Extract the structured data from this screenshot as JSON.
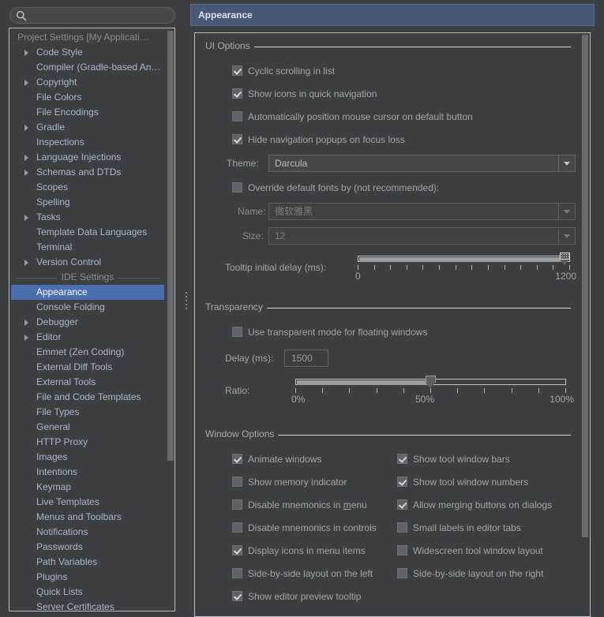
{
  "search": {
    "placeholder": "",
    "value": "",
    "icon": "search-icon"
  },
  "sidebar": {
    "project_group": "Project Settings [My Applicati…",
    "ide_group": "IDE Settings",
    "project_items": [
      {
        "label": "Code Style",
        "arrow": true
      },
      {
        "label": "Compiler (Gradle-based An…",
        "arrow": false
      },
      {
        "label": "Copyright",
        "arrow": true
      },
      {
        "label": "File Colors",
        "arrow": false
      },
      {
        "label": "File Encodings",
        "arrow": false
      },
      {
        "label": "Gradle",
        "arrow": true
      },
      {
        "label": "Inspections",
        "arrow": false
      },
      {
        "label": "Language Injections",
        "arrow": true
      },
      {
        "label": "Schemas and DTDs",
        "arrow": true
      },
      {
        "label": "Scopes",
        "arrow": false
      },
      {
        "label": "Spelling",
        "arrow": false
      },
      {
        "label": "Tasks",
        "arrow": true
      },
      {
        "label": "Template Data Languages",
        "arrow": false
      },
      {
        "label": "Terminal",
        "arrow": false
      },
      {
        "label": "Version Control",
        "arrow": true
      }
    ],
    "ide_items": [
      {
        "label": "Appearance",
        "arrow": false,
        "selected": true
      },
      {
        "label": "Console Folding",
        "arrow": false
      },
      {
        "label": "Debugger",
        "arrow": true
      },
      {
        "label": "Editor",
        "arrow": true
      },
      {
        "label": "Emmet (Zen Coding)",
        "arrow": false
      },
      {
        "label": "External Diff Tools",
        "arrow": false
      },
      {
        "label": "External Tools",
        "arrow": false
      },
      {
        "label": "File and Code Templates",
        "arrow": false
      },
      {
        "label": "File Types",
        "arrow": false
      },
      {
        "label": "General",
        "arrow": false
      },
      {
        "label": "HTTP Proxy",
        "arrow": false
      },
      {
        "label": "Images",
        "arrow": false
      },
      {
        "label": "Intentions",
        "arrow": false
      },
      {
        "label": "Keymap",
        "arrow": false
      },
      {
        "label": "Live Templates",
        "arrow": false
      },
      {
        "label": "Menus and Toolbars",
        "arrow": false
      },
      {
        "label": "Notifications",
        "arrow": false
      },
      {
        "label": "Passwords",
        "arrow": false
      },
      {
        "label": "Path Variables",
        "arrow": false
      },
      {
        "label": "Plugins",
        "arrow": false
      },
      {
        "label": "Quick Lists",
        "arrow": false
      },
      {
        "label": "Server Certificates",
        "arrow": false
      }
    ]
  },
  "panel": {
    "title": "Appearance",
    "ui_options": {
      "group_title": "UI Options",
      "checkboxes": [
        {
          "label": "Cyclic scrolling in list",
          "checked": true
        },
        {
          "label": "Show icons in quick navigation",
          "checked": true
        },
        {
          "label": "Automatically position mouse cursor on default button",
          "checked": false
        },
        {
          "label": "Hide navigation popups on focus loss",
          "checked": true
        }
      ],
      "theme_label": "Theme:",
      "theme_value": "Darcula",
      "override_fonts_label": "Override default fonts by (not recommended):",
      "override_fonts_checked": false,
      "name_label": "Name:",
      "name_value": "微软雅黑",
      "size_label": "Size:",
      "size_value": "12",
      "tooltip_delay_label": "Tooltip initial delay (ms):",
      "tooltip_delay_min": "0",
      "tooltip_delay_max": "1200",
      "tooltip_delay_value": 1200,
      "tooltip_delay_ticks": 14
    },
    "transparency": {
      "group_title": "Transparency",
      "transparent_mode_label": "Use transparent mode for floating windows",
      "transparent_mode_checked": false,
      "delay_label": "Delay (ms):",
      "delay_value": "1500",
      "ratio_label": "Ratio:",
      "ratio_min": "0%",
      "ratio_mid": "50%",
      "ratio_max": "100%",
      "ratio_value": 50,
      "ratio_ticks": 11
    },
    "window_options": {
      "group_title": "Window Options",
      "left_column": [
        {
          "label": "Animate windows",
          "checked": true
        },
        {
          "label": "Show memory indicator",
          "checked": false
        },
        {
          "label": "Disable mnemonics in ",
          "mnemonic": "m",
          "label_tail": "enu",
          "checked": false
        },
        {
          "label": "Disable mnemonics in controls",
          "checked": false
        },
        {
          "label": "Display icons in menu items",
          "checked": true
        },
        {
          "label": "Side-by-side layout on the left",
          "checked": false
        },
        {
          "label": "Show editor preview tooltip",
          "checked": true
        }
      ],
      "right_column": [
        {
          "label": "Show tool window bars",
          "checked": true
        },
        {
          "label": "Show tool window numbers",
          "checked": true
        },
        {
          "label": "Allow merging buttons on dialogs",
          "checked": true
        },
        {
          "label": "Small labels in editor tabs",
          "checked": false
        },
        {
          "label": "Widescreen tool window layout",
          "checked": false
        },
        {
          "label": "Side-by-side layout on the right",
          "checked": false
        }
      ]
    }
  },
  "colors": {
    "background": "#3c3f41",
    "selection": "#4b6eaf",
    "header": "#4a5878",
    "text": "#a9b7c6",
    "label": "#a9a399",
    "border": "#b5bcc4"
  }
}
